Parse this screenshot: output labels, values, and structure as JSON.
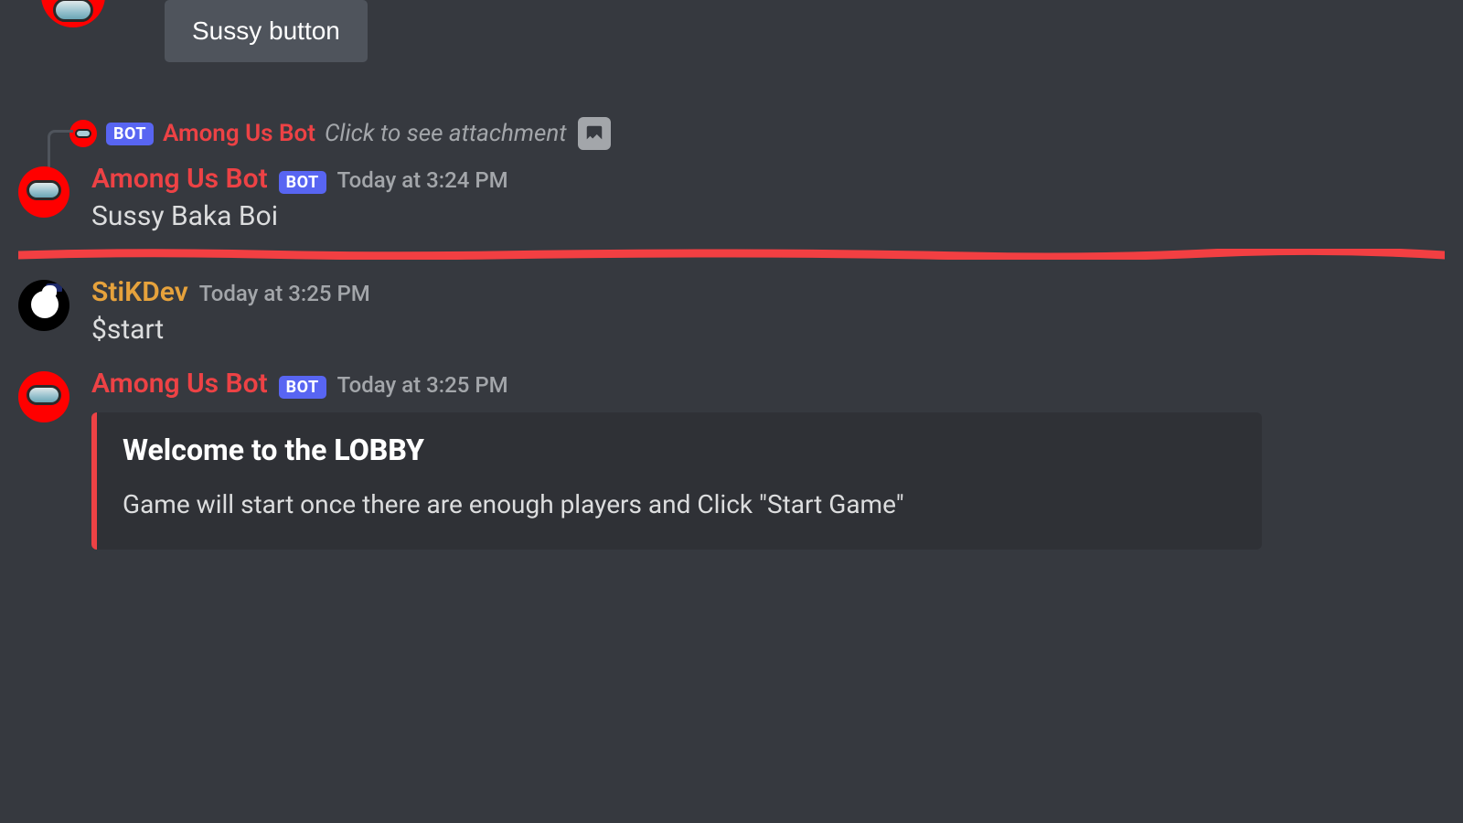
{
  "button_row": {
    "sussy_label": "Sussy button"
  },
  "bot_badge": "BOT",
  "reply": {
    "author": "Among Us Bot",
    "text": "Click to see attachment"
  },
  "messages": {
    "m1": {
      "author": "Among Us Bot",
      "timestamp": "Today at 3:24 PM",
      "body": "Sussy Baka Boi"
    },
    "m2": {
      "author": "StiKDev",
      "timestamp": "Today at 3:25 PM",
      "body": "$start"
    },
    "m3": {
      "author": "Among Us Bot",
      "timestamp": "Today at 3:25 PM"
    }
  },
  "embed": {
    "title_prefix": "Welcome to the ",
    "title_bold": "LOBBY",
    "description": "Game will start once there are enough players and Click \"Start Game\""
  }
}
